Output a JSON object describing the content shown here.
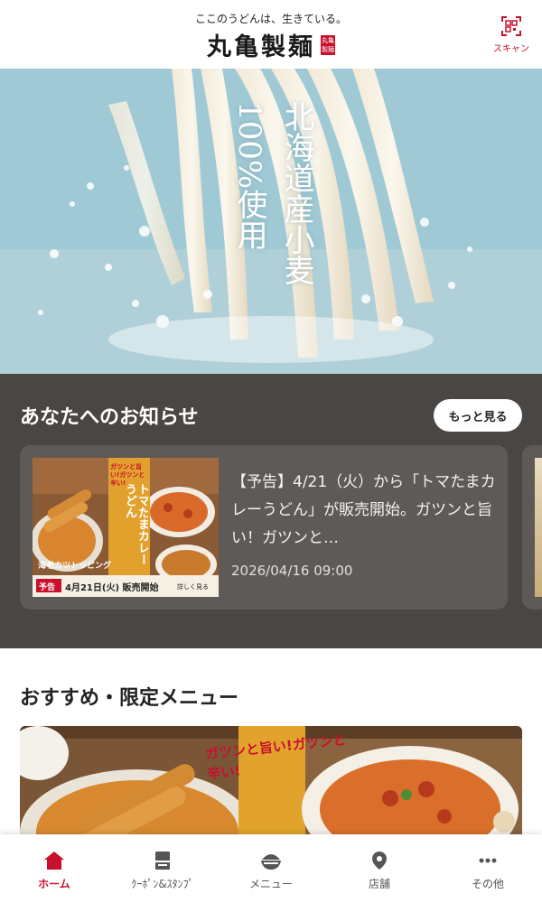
{
  "header": {
    "tagline": "ここのうどんは、生きている。",
    "logo": "丸亀製麺",
    "logo_seal": "丸亀製麺",
    "scan_label": "スキャン"
  },
  "hero": {
    "col_right": "北海道産小麦",
    "col_left": "100%使用"
  },
  "news": {
    "title": "あなたへのお知らせ",
    "more_button": "もっと見る",
    "items": [
      {
        "text": "【予告】4/21（火）から「トマたまカレーうどん」が販売開始。ガツンと旨い！ガツンと…",
        "date": "2026/04/16 09:00",
        "thumb": {
          "catch": "ガツンと旨い!ガツンと辛い!",
          "title": "トマたまカレーうどん",
          "sub": "海老カツトッピング",
          "badge": "予告",
          "date": "4月21日(火) 販売開始",
          "link": "詳しく見る"
        }
      }
    ]
  },
  "recommend": {
    "title": "おすすめ・限定メニュー",
    "banner_catch": "ガツンと旨い!ガツンと辛い!"
  },
  "tabs": [
    {
      "label": "ホーム",
      "icon": "home-icon",
      "active": true
    },
    {
      "label": "ｸｰﾎﾟﾝ&ｽﾀﾝﾌﾟ",
      "icon": "coupon-icon",
      "active": false
    },
    {
      "label": "メニュー",
      "icon": "menu-bowl-icon",
      "active": false
    },
    {
      "label": "店舗",
      "icon": "location-pin-icon",
      "active": false
    },
    {
      "label": "その他",
      "icon": "more-dots-icon",
      "active": false
    }
  ],
  "colors": {
    "brand_red": "#c8102e",
    "news_bg": "#4a4643",
    "card_bg": "#5e5a57"
  }
}
